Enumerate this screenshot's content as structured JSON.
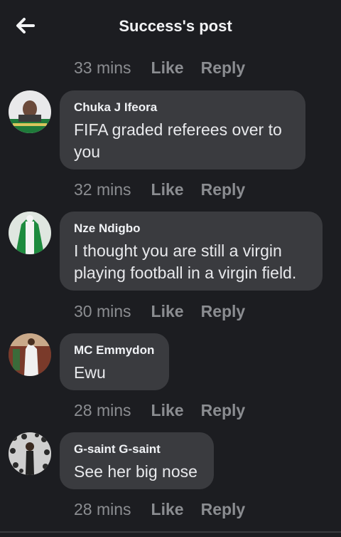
{
  "header": {
    "title": "Success's post",
    "back_icon": "arrow-left-icon"
  },
  "top_meta": {
    "time": "33 mins",
    "like": "Like",
    "reply": "Reply"
  },
  "comments": [
    {
      "author": "Chuka J Ifeora",
      "text": "FIFA graded referees over to you",
      "time": "32 mins",
      "like": "Like",
      "reply": "Reply"
    },
    {
      "author": "Nze Ndigbo",
      "text": "I thought you are still a virgin playing football in a virgin field.",
      "time": "30 mins",
      "like": "Like",
      "reply": "Reply"
    },
    {
      "author": "MC Emmydon",
      "text": "Ewu",
      "time": "28 mins",
      "like": "Like",
      "reply": "Reply"
    },
    {
      "author": "G-saint G-saint",
      "text": "See her big nose",
      "time": "28 mins",
      "like": "Like",
      "reply": "Reply"
    }
  ],
  "colors": {
    "background": "#1c1d21",
    "bubble": "#3a3b3f",
    "meta": "#8b8d91"
  }
}
